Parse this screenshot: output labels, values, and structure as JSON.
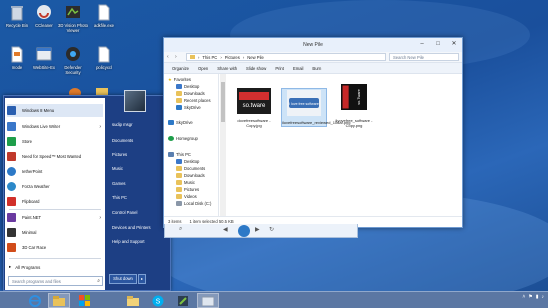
{
  "desktop": {
    "icons": [
      {
        "label": "Recycle Bin",
        "icon": "recycle-bin-icon"
      },
      {
        "label": "CCleaner",
        "icon": "ccleaner-icon"
      },
      {
        "label": "3D Vision Photo Viewer",
        "icon": "3d-vision-icon"
      },
      {
        "label": "adkfile.exe",
        "icon": "file-icon"
      },
      {
        "label": "mode",
        "icon": "file-icon"
      },
      {
        "label": "WebSite-Ex",
        "icon": "website-icon"
      },
      {
        "label": "Defender Security",
        "icon": "defender-icon"
      },
      {
        "label": "policyxcl",
        "icon": "file-icon"
      }
    ]
  },
  "start_menu": {
    "items": [
      {
        "label": "Windows 8 Menu",
        "color": "#2a5fb0",
        "arrow": ""
      },
      {
        "label": "Windows Live Writer",
        "color": "#3a77c9",
        "arrow": "›"
      },
      {
        "label": "Store",
        "color": "#1e9e4a",
        "arrow": ""
      },
      {
        "label": "Need for Speed™ Most Wanted",
        "color": "#c0392b",
        "arrow": ""
      },
      {
        "label": "IetherPoint",
        "color": "#2d79c7",
        "arrow": ""
      },
      {
        "label": "Forza Weather",
        "color": "#2c89c9",
        "arrow": ""
      },
      {
        "label": "Flipboard",
        "color": "#d1302a",
        "arrow": ""
      },
      {
        "label": "Paint.NET",
        "color": "#6a3aa0",
        "arrow": "›"
      },
      {
        "label": "Minimal",
        "color": "#333333",
        "arrow": ""
      },
      {
        "label": "3D Car Race",
        "color": "#d14c1a",
        "arrow": ""
      }
    ],
    "all_programs": "All Programs",
    "search_placeholder": "Search programs and files",
    "right_items": [
      "sudip msgr",
      "Documents",
      "Pictures",
      "Music",
      "Games",
      "This PC",
      "Control Panel",
      "Devices and Printers",
      "Help and Support"
    ],
    "shutdown": "Shut down"
  },
  "explorer": {
    "title": "New Pile",
    "address": {
      "segments": [
        "This PC",
        "Pictures",
        "New Pile"
      ]
    },
    "search_placeholder": "Search New Pile",
    "toolbar": [
      "Organize",
      "Open",
      "Share with",
      "Slide show",
      "Print",
      "Email",
      "Burn"
    ],
    "nav": [
      {
        "label": "Favorites",
        "level": 0
      },
      {
        "label": "Desktop",
        "level": 1
      },
      {
        "label": "Downloads",
        "level": 1
      },
      {
        "label": "Recent places",
        "level": 1
      },
      {
        "label": "SkyDrive",
        "level": 1
      },
      {
        "label": "SkyDrive",
        "level": 0
      },
      {
        "label": "Homegroup",
        "level": 0
      },
      {
        "label": "This PC",
        "level": 0
      },
      {
        "label": "Desktop",
        "level": 1
      },
      {
        "label": "Documents",
        "level": 1
      },
      {
        "label": "Downloads",
        "level": 1
      },
      {
        "label": "Music",
        "level": 1
      },
      {
        "label": "Pictures",
        "level": 1
      },
      {
        "label": "Videos",
        "level": 1
      },
      {
        "label": "Local Disk (C:)",
        "level": 1
      }
    ],
    "files": [
      {
        "name": "dovefreesoftware - Copy.jpg",
        "thumb_text": "so.tware"
      },
      {
        "name": "ilovefreesoftware_reviewed_106ar.png",
        "thumb_text": "I love free software"
      },
      {
        "name": "ilyovefree_software - Copy.png",
        "thumb_text": "so.Tware"
      }
    ],
    "status": {
      "items": "3 items",
      "selected": "1 item selected 50.5 KB"
    }
  },
  "taskbar": {
    "apps": [
      "ie-icon",
      "explorer-icon",
      "windows-icon",
      "folder-icon",
      "skype-icon",
      "tool-icon",
      "explorer2-icon"
    ],
    "tray": [
      "chevron-up-icon",
      "flag-icon",
      "network-icon",
      "volume-icon"
    ]
  }
}
